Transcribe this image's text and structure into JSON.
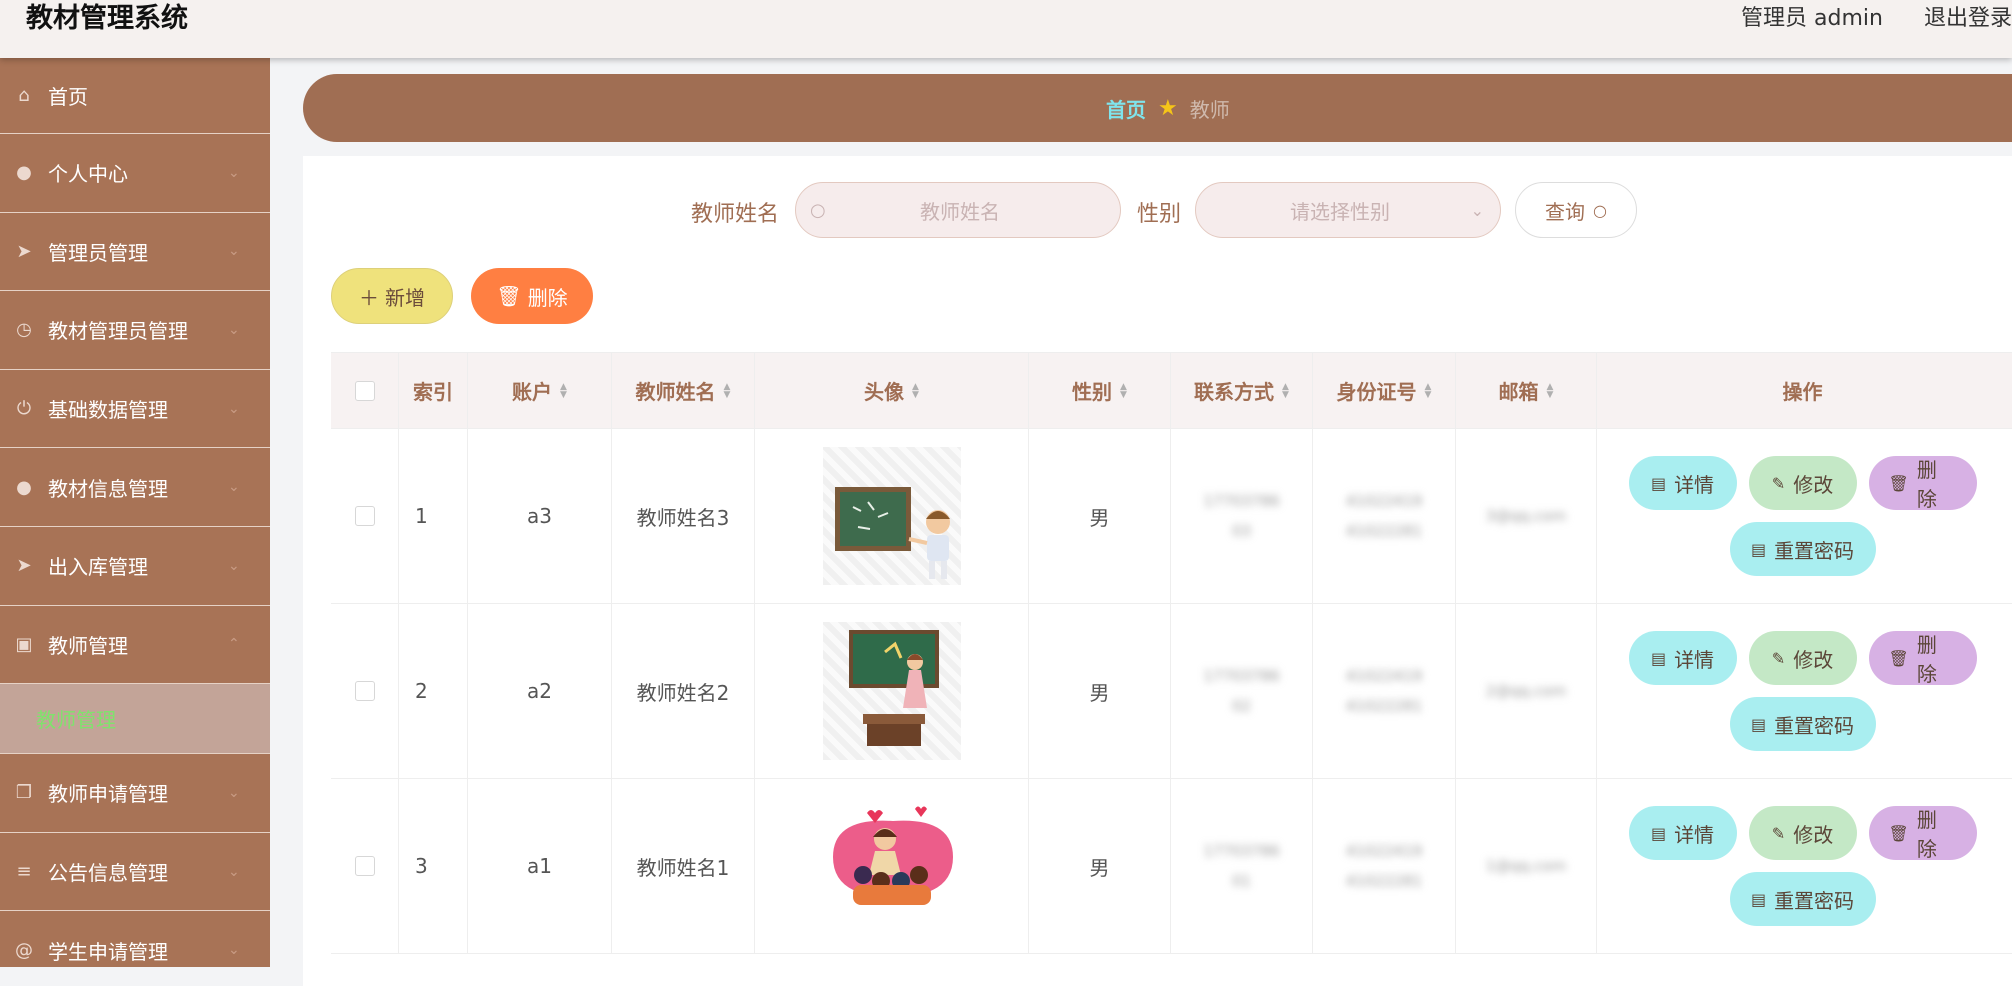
{
  "header": {
    "title": "教材管理系统",
    "user": "管理员 admin",
    "logout": "退出登录"
  },
  "sidebar": {
    "items": [
      {
        "label": "首页",
        "icon": "home-icon"
      },
      {
        "label": "个人中心",
        "icon": "user-icon"
      },
      {
        "label": "管理员管理",
        "icon": "send-icon"
      },
      {
        "label": "教材管理员管理",
        "icon": "clock-icon"
      },
      {
        "label": "基础数据管理",
        "icon": "power-icon"
      },
      {
        "label": "教材信息管理",
        "icon": "pin-icon"
      },
      {
        "label": "出入库管理",
        "icon": "send-icon"
      },
      {
        "label": "教师管理",
        "icon": "clipboard-icon",
        "expanded": true
      },
      {
        "label": "教师申请管理",
        "icon": "copy-icon"
      },
      {
        "label": "公告信息管理",
        "icon": "sliders-icon"
      },
      {
        "label": "学生申请管理",
        "icon": "at-icon"
      }
    ],
    "submenu": {
      "label": "教师管理"
    }
  },
  "breadcrumb": {
    "home": "首页",
    "current": "教师"
  },
  "search": {
    "name_label": "教师姓名",
    "name_placeholder": "教师姓名",
    "gender_label": "性别",
    "gender_placeholder": "请选择性别",
    "query_label": "查询"
  },
  "actions": {
    "add_label": "新增",
    "delete_label": "删除"
  },
  "table": {
    "columns": {
      "index": "索引",
      "account": "账户",
      "name": "教师姓名",
      "avatar": "头像",
      "gender": "性别",
      "phone": "联系方式",
      "idcard": "身份证号",
      "email": "邮箱",
      "ops": "操作"
    },
    "rows": [
      {
        "index": "1",
        "account": "a3",
        "name": "教师姓名3",
        "gender": "男",
        "phone_1": "17703786",
        "phone_2": "03",
        "id_1": "41022419",
        "id_2": "41022281",
        "email": "3@qq.com"
      },
      {
        "index": "2",
        "account": "a2",
        "name": "教师姓名2",
        "gender": "男",
        "phone_1": "17703786",
        "phone_2": "02",
        "id_1": "41022419",
        "id_2": "41022281",
        "email": "2@qq.com"
      },
      {
        "index": "3",
        "account": "a1",
        "name": "教师姓名1",
        "gender": "男",
        "phone_1": "17703786",
        "phone_2": "01",
        "id_1": "41022419",
        "id_2": "41022281",
        "email": "1@qq.com"
      }
    ],
    "ops": {
      "detail": "详情",
      "edit": "修改",
      "delete": "删除",
      "reset": "重置密码"
    }
  }
}
